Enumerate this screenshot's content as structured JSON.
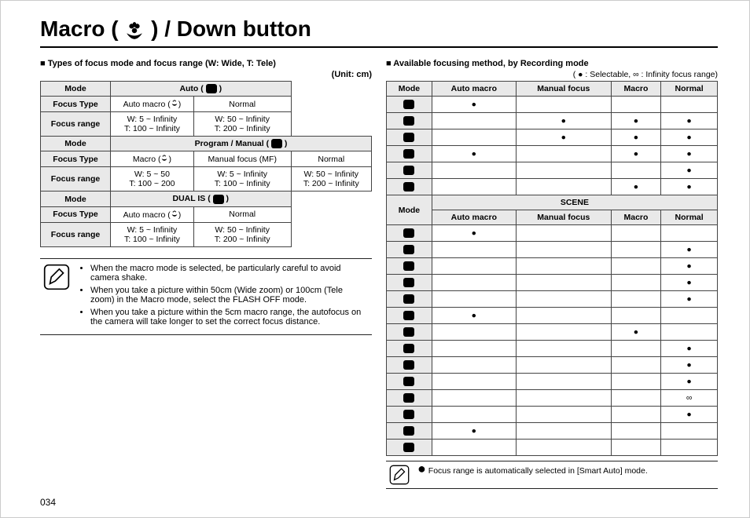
{
  "title_pre": "Macro (",
  "title_post": ") / Down button",
  "left": {
    "heading": "Types of focus mode and focus range (W: Wide, T: Tele)",
    "unit": "(Unit: cm)",
    "labels": {
      "mode": "Mode",
      "focus_type": "Focus Type",
      "focus_range": "Focus range"
    },
    "groups": [
      {
        "mode": "Auto",
        "icon": "■",
        "types": [
          {
            "name": "Auto macro",
            "range_w": "W: 5 ~ Infinity",
            "range_t": "T: 100 ~ Infinity"
          },
          {
            "name": "Normal",
            "range_w": "W: 50 ~ Infinity",
            "range_t": "T: 200 ~ Infinity"
          }
        ]
      },
      {
        "mode": "Program / Manual",
        "icon": "P M",
        "types": [
          {
            "name": "Macro",
            "range_w": "W: 5 ~ 50",
            "range_t": "T: 100 ~ 200"
          },
          {
            "name": "Manual focus (MF)",
            "range_w": "W: 5 ~ Infinity",
            "range_t": "T: 100 ~ Infinity"
          },
          {
            "name": "Normal",
            "range_w": "W: 50 ~ Infinity",
            "range_t": "T: 200 ~ Infinity"
          }
        ]
      },
      {
        "mode": "DUAL IS",
        "icon": "■",
        "types": [
          {
            "name": "Auto macro",
            "range_w": "W: 5 ~ Infinity",
            "range_t": "T: 100 ~ Infinity"
          },
          {
            "name": "Normal",
            "range_w": "W: 50 ~ Infinity",
            "range_t": "T: 200 ~ Infinity"
          }
        ]
      }
    ],
    "tips": [
      "When the macro mode is selected, be particularly careful to avoid camera shake.",
      "When you take a picture within 50cm (Wide zoom) or 100cm (Tele zoom) in the Macro mode, select the FLASH OFF mode.",
      "When you take a picture within the 5cm macro range, the autofocus on the camera will take longer to set the correct focus distance."
    ]
  },
  "right": {
    "heading": "Available focusing method, by Recording mode",
    "legend": "( ● : Selectable, ∞ : Infinity focus range)",
    "cols": {
      "mode": "Mode",
      "auto_macro": "Auto macro",
      "manual_focus": "Manual focus",
      "macro": "Macro",
      "normal": "Normal"
    },
    "section_scene": "SCENE",
    "rows_top": [
      {
        "auto_macro": "●",
        "manual_focus": "",
        "macro": "",
        "normal": ""
      },
      {
        "auto_macro": "",
        "manual_focus": "●",
        "macro": "●",
        "normal": "●"
      },
      {
        "auto_macro": "",
        "manual_focus": "●",
        "macro": "●",
        "normal": "●"
      },
      {
        "auto_macro": "●",
        "manual_focus": "",
        "macro": "●",
        "normal": "●"
      },
      {
        "auto_macro": "",
        "manual_focus": "",
        "macro": "",
        "normal": "●"
      },
      {
        "auto_macro": "",
        "manual_focus": "",
        "macro": "●",
        "normal": "●"
      }
    ],
    "rows_scene": [
      {
        "auto_macro": "●",
        "manual_focus": "",
        "macro": "",
        "normal": ""
      },
      {
        "auto_macro": "",
        "manual_focus": "",
        "macro": "",
        "normal": "●"
      },
      {
        "auto_macro": "",
        "manual_focus": "",
        "macro": "",
        "normal": "●"
      },
      {
        "auto_macro": "",
        "manual_focus": "",
        "macro": "",
        "normal": "●"
      },
      {
        "auto_macro": "",
        "manual_focus": "",
        "macro": "",
        "normal": "●"
      },
      {
        "auto_macro": "●",
        "manual_focus": "",
        "macro": "",
        "normal": ""
      },
      {
        "auto_macro": "",
        "manual_focus": "",
        "macro": "●",
        "normal": ""
      },
      {
        "auto_macro": "",
        "manual_focus": "",
        "macro": "",
        "normal": "●"
      },
      {
        "auto_macro": "",
        "manual_focus": "",
        "macro": "",
        "normal": "●"
      },
      {
        "auto_macro": "",
        "manual_focus": "",
        "macro": "",
        "normal": "●"
      },
      {
        "auto_macro": "",
        "manual_focus": "",
        "macro": "",
        "normal": "∞"
      },
      {
        "auto_macro": "",
        "manual_focus": "",
        "macro": "",
        "normal": "●"
      },
      {
        "auto_macro": "●",
        "manual_focus": "",
        "macro": "",
        "normal": ""
      },
      {
        "auto_macro": "",
        "manual_focus": "",
        "macro": "",
        "normal": ""
      }
    ],
    "footnote": "Focus range is automatically selected in [Smart Auto] mode."
  },
  "page_number": "034"
}
